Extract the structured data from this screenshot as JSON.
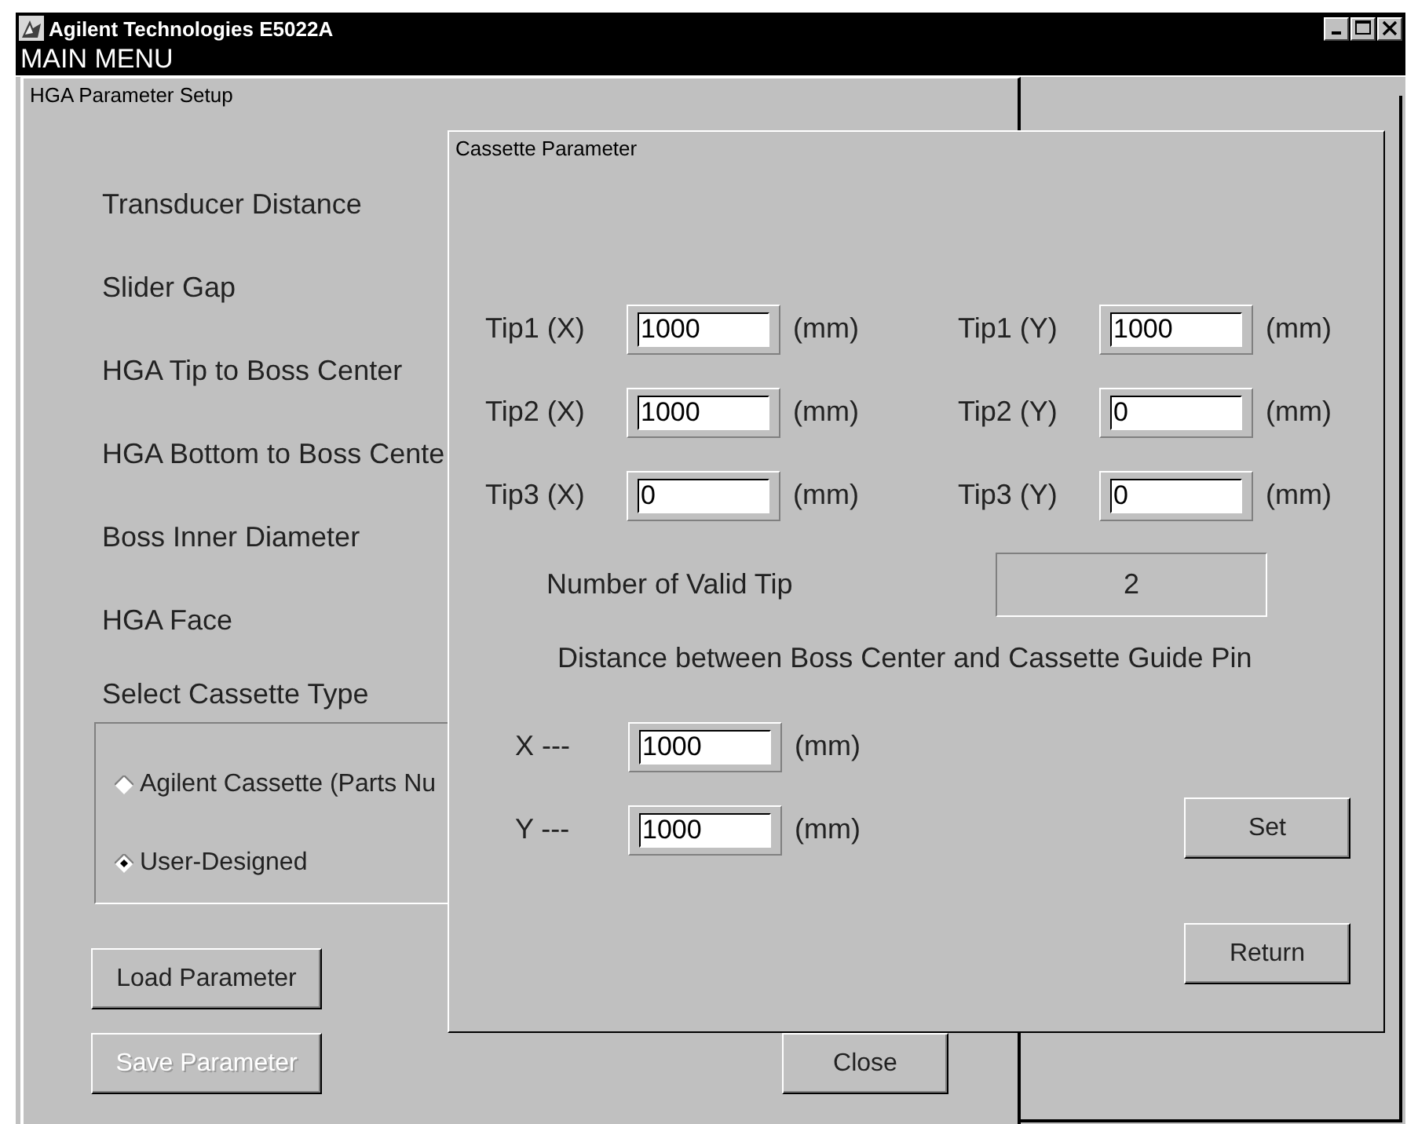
{
  "window": {
    "title": "Agilent Technologies E5022A"
  },
  "menu_bar": {
    "label": "MAIN MENU"
  },
  "setup_panel": {
    "title": "HGA Parameter Setup",
    "parameters": [
      "Transducer Distance",
      "Slider Gap",
      "HGA Tip to Boss Center",
      "HGA Bottom to Boss Cente",
      "Boss Inner Diameter",
      "HGA Face"
    ],
    "cassette_type": {
      "label": "Select Cassette Type",
      "options": [
        {
          "label": "Agilent Cassette (Parts Nu",
          "selected": false
        },
        {
          "label": "User-Designed",
          "selected": true
        }
      ]
    },
    "buttons": [
      {
        "label": "Load Parameter",
        "disabled": false
      },
      {
        "label": "Save Parameter",
        "disabled": true
      }
    ],
    "close_button": "Close"
  },
  "cassette_dialog": {
    "title": "Cassette Parameter",
    "tips": [
      {
        "label": "Tip1 (X)",
        "value": "1000",
        "unit": "(mm)"
      },
      {
        "label": "Tip1 (Y)",
        "value": "1000",
        "unit": "(mm)"
      },
      {
        "label": "Tip2 (X)",
        "value": "1000",
        "unit": "(mm)"
      },
      {
        "label": "Tip2 (Y)",
        "value": "0",
        "unit": "(mm)"
      },
      {
        "label": "Tip3 (X)",
        "value": "0",
        "unit": "(mm)"
      },
      {
        "label": "Tip3 (Y)",
        "value": "0",
        "unit": "(mm)"
      }
    ],
    "valid_tip": {
      "label": "Number of Valid Tip",
      "value": "2"
    },
    "distance": {
      "label": "Distance between Boss Center and Cassette Guide Pin",
      "fields": [
        {
          "label": "X ---",
          "value": "1000",
          "unit": "(mm)"
        },
        {
          "label": "Y ---",
          "value": "1000",
          "unit": "(mm)"
        }
      ]
    },
    "buttons": [
      "Set",
      "Return"
    ]
  }
}
